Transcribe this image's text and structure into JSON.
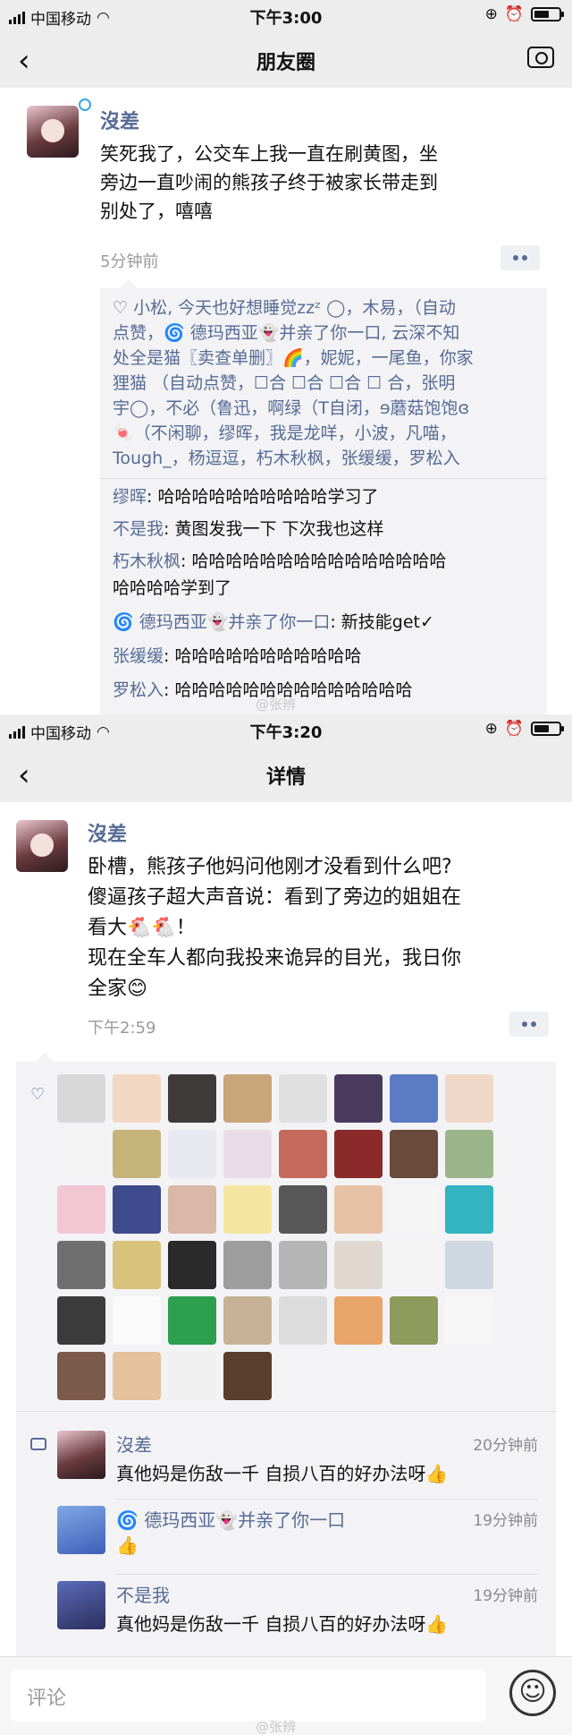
{
  "screen1": {
    "status": {
      "carrier": "中国移动",
      "time": "下午3:00"
    },
    "nav": {
      "back": "‹",
      "title": "朋友圈"
    },
    "post": {
      "author": "沒差",
      "text_lines": [
        "笑死我了，公交车上我一直在刷黄图，坐",
        "旁边一直吵闹的熊孩子终于被家长带走到",
        "别处了，嘻嘻"
      ],
      "time": "5分钟前"
    },
    "likes_lines": [
      "♡ 小松, 今天也好想睡觉zzᶻ ◯，木易，（自动",
      "点赞，🌀 德玛西亚👻并亲了你一口, 云深不知",
      "处全是猫〖卖查单删〗🌈，妮妮，一尾鱼，你家",
      "狸猫 （自动点赞，☐合 ☐合 ☐合 ☐ 合，张明",
      "宇◯，不必（鲁迅，啊绿（T自闭，ɘ蘑菇饱饱ɞ",
      "🍬（不闲聊，缪晖，我是龙咩，小波，凡喵，",
      "Tough_，杨逗逗，朽木秋枫，张缓缓，罗松入"
    ],
    "comments": [
      {
        "who": "缪晖",
        "text": ": 哈哈哈哈哈哈哈哈哈哈学习了"
      },
      {
        "who": "不是我",
        "text": ": 黄图发我一下 下次我也这样"
      },
      {
        "who": "朽木秋枫",
        "text": ": 哈哈哈哈哈哈哈哈哈哈哈哈哈哈哈"
      },
      {
        "who": "",
        "text": "哈哈哈哈学到了"
      },
      {
        "who": "🌀 德玛西亚👻并亲了你一口",
        "text": ": 新技能get✓"
      },
      {
        "who": "张缓缓",
        "text": ": 哈哈哈哈哈哈哈哈哈哈哈"
      },
      {
        "who": "罗松入",
        "text": ": 哈哈哈哈哈哈哈哈哈哈哈哈哈哈"
      }
    ],
    "watermark": "@张辨"
  },
  "screen2": {
    "status": {
      "carrier": "中国移动",
      "time": "下午3:20"
    },
    "nav": {
      "back": "‹",
      "title": "详情"
    },
    "post": {
      "author": "沒差",
      "text_lines": [
        "卧槽，熊孩子他妈问他刚才没看到什么吧?",
        "傻逼孩子超大声音说：看到了旁边的姐姐在",
        "看大🐔🐔！",
        "现在全车人都向我投来诡异的目光，我日你",
        "全家😊"
      ],
      "time": "下午2:59"
    },
    "like_avatar_colors": [
      "#d8d8d8",
      "#f1d6c2",
      "#3f3a3a",
      "#c9a57a",
      "#e0e0e0",
      "#4a3a5e",
      "#5b7bc4",
      "#f0d8c8",
      "#f4f4f4",
      "#c5b37a",
      "#e8e8f0",
      "#e9dce6",
      "#c46a5a",
      "#8a2a2a",
      "#6a4a3a",
      "#9bb58a",
      "#f3c6d3",
      "#3e4b8c",
      "#d9b8a8",
      "#f4e6a0",
      "#575757",
      "#e8c2a4",
      "#f5f5f5",
      "#34b3c0",
      "#6f6f6f",
      "#d9c27a",
      "#2a2a2a",
      "#9d9d9d",
      "#b5b5b5",
      "#e0d8d0",
      "#f4f4f4",
      "#cfd8e0",
      "#3b3b3b",
      "#fafafa",
      "#2e9e4f",
      "#c7b196",
      "#dcdcdc",
      "#e8a56a",
      "#8c9a5c",
      "#f7f7f7",
      "#7a5a4a",
      "#e5c19c",
      "#efefef",
      "#5a3e2e"
    ],
    "comments": [
      {
        "name": "沒差",
        "time": "20分钟前",
        "text": "真他妈是伤敌一千 自损八百的好办法呀👍"
      },
      {
        "name": "🌀 德玛西亚👻并亲了你一口",
        "time": "19分钟前",
        "text": "👍"
      },
      {
        "name": "不是我",
        "time": "19分钟前",
        "text": "真他妈是伤敌一千 自损八百的好办法呀👍"
      }
    ],
    "input_placeholder": "评论",
    "emoji_label": "☺",
    "watermark": "@张辨"
  }
}
